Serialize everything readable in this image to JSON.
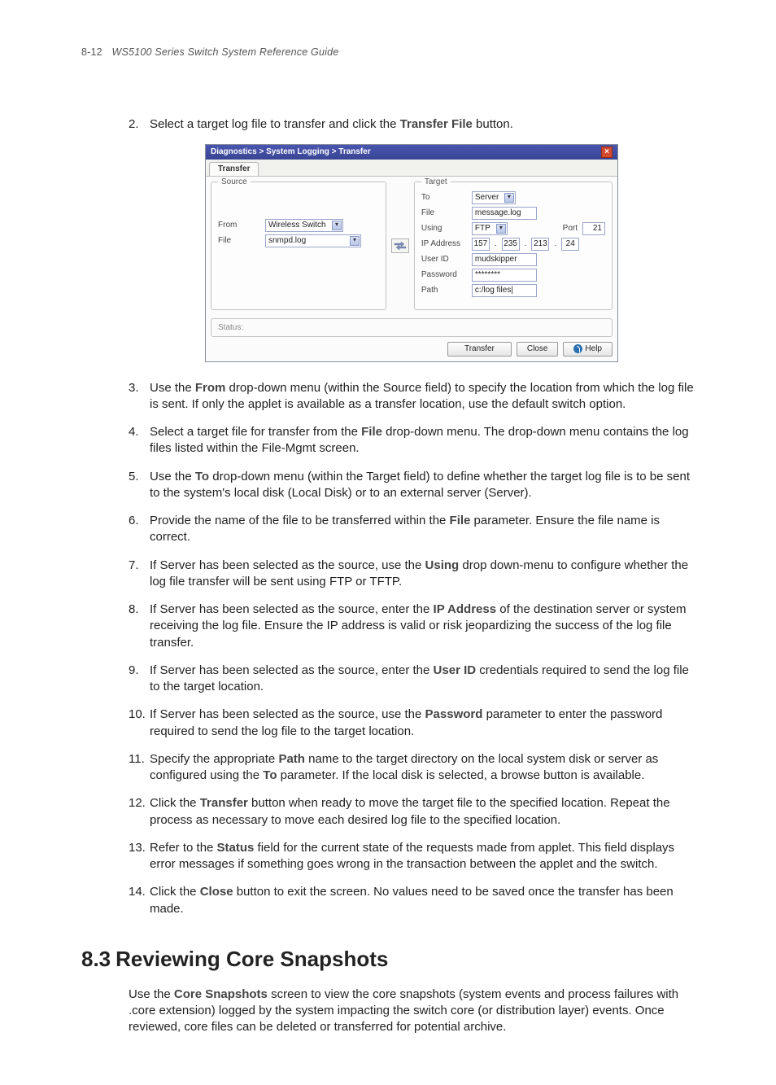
{
  "header": {
    "page_number": "8-12",
    "title": "WS5100 Series Switch System Reference Guide"
  },
  "steps": {
    "s2": {
      "num": "2.",
      "pre": "Select a target log file to transfer and click the ",
      "bold": "Transfer File",
      "post": " button."
    },
    "s3": {
      "num": "3.",
      "pre": "Use the ",
      "bold": "From",
      "post": " drop-down menu (within the Source field) to specify the location from which the log file is sent. If only the applet is available as a transfer location, use the default switch option."
    },
    "s4": {
      "num": "4.",
      "pre": "Select a target file for transfer from the ",
      "bold": "File",
      "post": " drop-down menu. The drop-down menu contains the log files listed within the File-Mgmt screen."
    },
    "s5": {
      "num": "5.",
      "pre": "Use the ",
      "bold": "To",
      "post": " drop-down menu (within the Target field) to define whether the target log file is to be sent to the system's local disk (Local Disk) or to an external server (Server)."
    },
    "s6": {
      "num": "6.",
      "pre": "Provide the name of the file to be transferred within the ",
      "bold": "File",
      "post": " parameter. Ensure the file name is correct."
    },
    "s7": {
      "num": "7.",
      "pre": "If Server has been selected as the source, use the ",
      "bold": "Using",
      "post": " drop down-menu to configure whether the log file transfer will be sent using FTP or TFTP."
    },
    "s8": {
      "num": "8.",
      "pre": "If Server has been selected as the source, enter the ",
      "bold": "IP Address",
      "post": " of the destination server or system receiving the log file. Ensure the IP address is valid or risk jeopardizing the success of the log file transfer."
    },
    "s9": {
      "num": "9.",
      "pre": "If Server has been selected as the source, enter the ",
      "bold": "User ID",
      "post": " credentials required to send the log file to the target location."
    },
    "s10": {
      "num": "10.",
      "pre": "If Server has been selected as the source, use the ",
      "bold": "Password",
      "post": " parameter to enter the password required to send the log file to the target location."
    },
    "s11": {
      "num": "11.",
      "pre": "Specify the appropriate ",
      "bold": "Path",
      "mid": " name to the target directory on the local system disk or server as configured using the ",
      "bold2": "To",
      "post": " parameter. If the local disk is selected, a browse button is available."
    },
    "s12": {
      "num": "12.",
      "pre": "Click the ",
      "bold": "Transfer",
      "post": " button when ready to move the target file to the specified location. Repeat the process as necessary to move each desired log file to the specified location."
    },
    "s13": {
      "num": "13.",
      "pre": "Refer to the ",
      "bold": "Status",
      "post": " field for the current state of the requests made from applet. This field displays error messages if something goes wrong in the transaction between the applet and the switch."
    },
    "s14": {
      "num": "14.",
      "pre": "Click the ",
      "bold": "Close",
      "post": " button to exit the screen. No values need to be saved once the transfer has been made."
    }
  },
  "dialog": {
    "breadcrumb": "Diagnostics  >  System Logging  >  Transfer",
    "tab": "Transfer",
    "source": {
      "legend": "Source",
      "from_label": "From",
      "from_value": "Wireless Switch",
      "file_label": "File",
      "file_value": "snmpd.log"
    },
    "target": {
      "legend": "Target",
      "to_label": "To",
      "to_value": "Server",
      "file_label": "File",
      "file_value": "message.log",
      "using_label": "Using",
      "using_value": "FTP",
      "port_label": "Port",
      "port_value": "21",
      "ip_label": "IP Address",
      "ip1": "157",
      "ip2": "235",
      "ip3": "213",
      "ip4": "24",
      "user_label": "User ID",
      "user_value": "mudskipper",
      "pwd_label": "Password",
      "pwd_value": "********",
      "path_label": "Path",
      "path_value": "c:/log files|"
    },
    "status_label": "Status:",
    "buttons": {
      "transfer": "Transfer",
      "close": "Close",
      "help": "Help"
    }
  },
  "section": {
    "num": "8.3",
    "title": "Reviewing Core Snapshots",
    "body_pre": "Use the ",
    "body_bold": "Core Snapshots",
    "body_post": " screen to view the core snapshots (system events and process failures with .core extension) logged by the system impacting the switch core (or distribution layer) events. Once reviewed, core files can be deleted or transferred for potential archive."
  }
}
